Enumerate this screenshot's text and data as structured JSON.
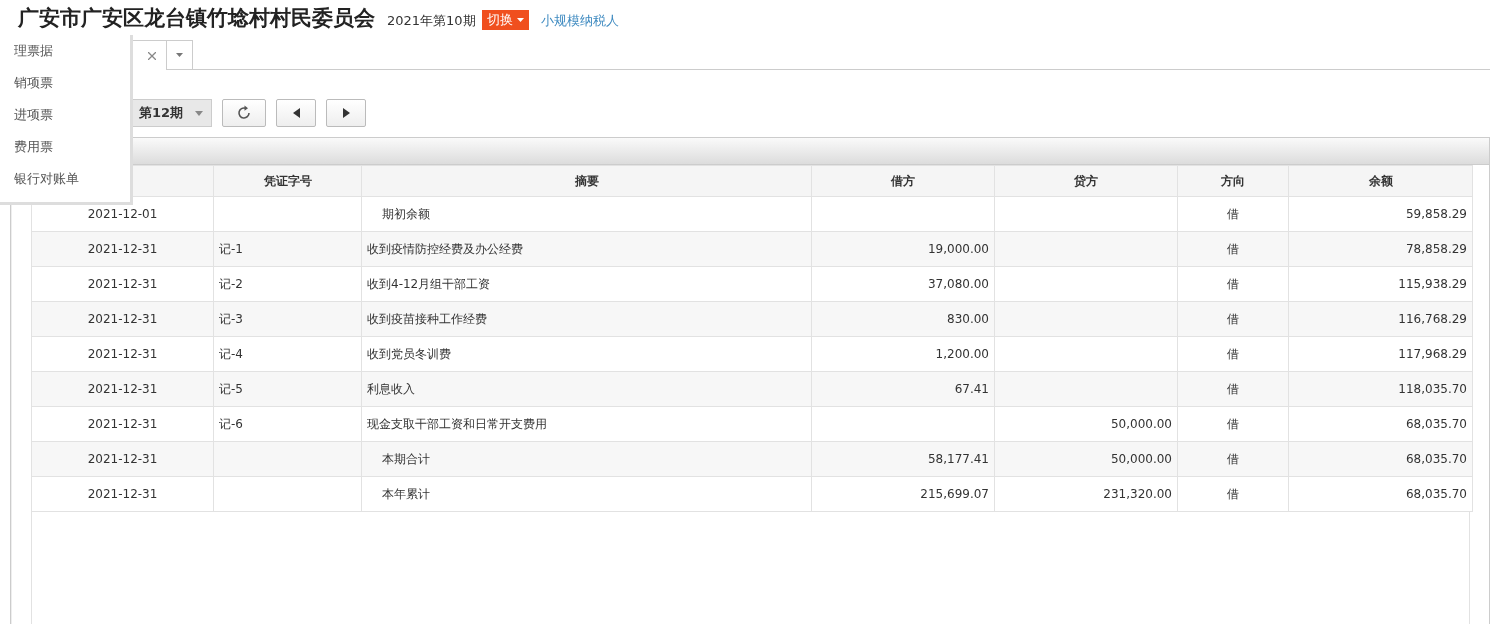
{
  "header": {
    "title": "广安市广安区龙台镇竹埝村村民委员会",
    "period": "2021年第10期",
    "switch_button": "切换",
    "taxpayer_link": "小规模纳税人"
  },
  "tabs": [
    {
      "selected": true,
      "closable": true
    }
  ],
  "toolbar": {
    "period_select": "第12期"
  },
  "table": {
    "columns": [
      "凭证字号",
      "摘要",
      "借方",
      "贷方",
      "方向",
      "余额"
    ],
    "rows": [
      {
        "kind": "summary",
        "date": "2021-12-01",
        "voucher": "",
        "summary": "期初余额",
        "debit": "",
        "credit": "",
        "direction": "借",
        "balance": "59,858.29"
      },
      {
        "kind": "entry",
        "date": "2021-12-31",
        "voucher": "记-1",
        "summary": "收到疫情防控经费及办公经费",
        "debit": "19,000.00",
        "credit": "",
        "direction": "借",
        "balance": "78,858.29"
      },
      {
        "kind": "entry",
        "date": "2021-12-31",
        "voucher": "记-2",
        "summary": "收到4-12月组干部工资",
        "debit": "37,080.00",
        "credit": "",
        "direction": "借",
        "balance": "115,938.29"
      },
      {
        "kind": "entry",
        "date": "2021-12-31",
        "voucher": "记-3",
        "summary": "收到疫苗接种工作经费",
        "debit": "830.00",
        "credit": "",
        "direction": "借",
        "balance": "116,768.29"
      },
      {
        "kind": "entry",
        "date": "2021-12-31",
        "voucher": "记-4",
        "summary": "收到党员冬训费",
        "debit": "1,200.00",
        "credit": "",
        "direction": "借",
        "balance": "117,968.29"
      },
      {
        "kind": "entry",
        "date": "2021-12-31",
        "voucher": "记-5",
        "summary": "利息收入",
        "debit": "67.41",
        "credit": "",
        "direction": "借",
        "balance": "118,035.70"
      },
      {
        "kind": "entry",
        "date": "2021-12-31",
        "voucher": "记-6",
        "summary": "现金支取干部工资和日常开支费用",
        "debit": "",
        "credit": "50,000.00",
        "direction": "借",
        "balance": "68,035.70"
      },
      {
        "kind": "summary",
        "date": "2021-12-31",
        "voucher": "",
        "summary": "本期合计",
        "debit": "58,177.41",
        "credit": "50,000.00",
        "direction": "借",
        "balance": "68,035.70"
      },
      {
        "kind": "summary",
        "date": "2021-12-31",
        "voucher": "",
        "summary": "本年累计",
        "debit": "215,699.07",
        "credit": "231,320.00",
        "direction": "借",
        "balance": "68,035.70"
      }
    ]
  },
  "menu": {
    "items": [
      "理票据",
      "销项票",
      "进项票",
      "费用票",
      "银行对账单"
    ]
  }
}
